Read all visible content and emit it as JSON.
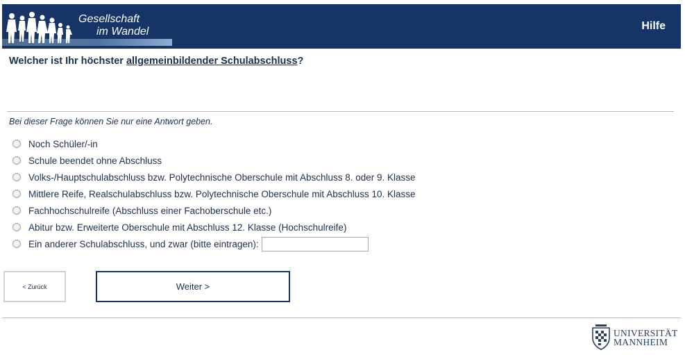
{
  "header": {
    "logo_line1": "Gesellschaft",
    "logo_line2": "im Wandel",
    "help_label": "Hilfe",
    "bg_color": "#163566"
  },
  "question": {
    "prefix": "Welcher ist Ihr höchster ",
    "underlined": "allgemeinbildender Schulabschluss",
    "suffix": "?"
  },
  "instruction": "Bei dieser Frage können Sie nur eine Antwort geben.",
  "options": [
    {
      "label": "Noch Schüler/-in"
    },
    {
      "label": "Schule beendet ohne Abschluss"
    },
    {
      "label": "Volks-/Hauptschulabschluss bzw. Polytechnische Oberschule mit Abschluss 8. oder 9. Klasse"
    },
    {
      "label": "Mittlere Reife, Realschulabschluss bzw. Polytechnische Oberschule mit Abschluss 10. Klasse"
    },
    {
      "label": "Fachhochschulreife (Abschluss einer Fachoberschule etc.)"
    },
    {
      "label": "Abitur bzw. Erweiterte Oberschule mit Abschluss 12. Klasse (Hochschulreife)"
    },
    {
      "label": "Ein anderer Schulabschluss, und zwar (bitte eintragen):"
    }
  ],
  "other_input_value": "",
  "buttons": {
    "back": "< Zurück",
    "next": "Weiter >"
  },
  "footer": {
    "uni_line1": "UNIVERSITÄT",
    "uni_line2": "MANNHEIM"
  }
}
